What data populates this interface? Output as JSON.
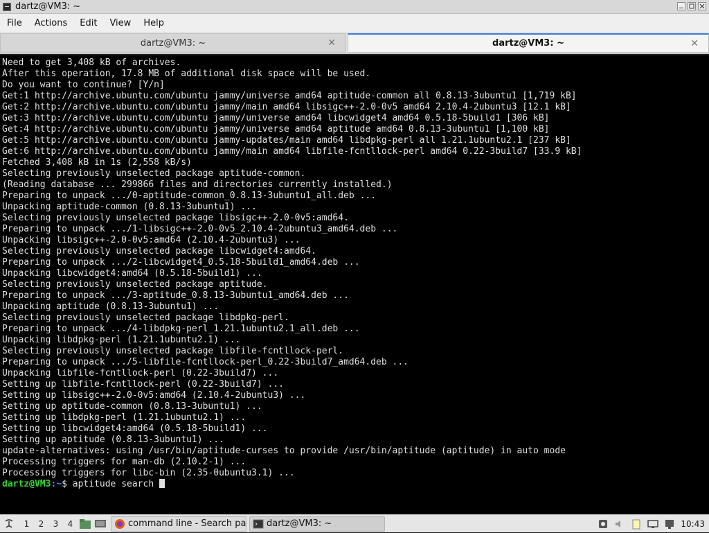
{
  "window": {
    "title": "dartz@VM3: ~"
  },
  "menu": [
    "File",
    "Actions",
    "Edit",
    "View",
    "Help"
  ],
  "tabs": [
    {
      "label": "dartz@VM3: ~",
      "active": false
    },
    {
      "label": "dartz@VM3: ~",
      "active": true
    }
  ],
  "terminal": {
    "lines": [
      "Need to get 3,408 kB of archives.",
      "After this operation, 17.8 MB of additional disk space will be used.",
      "Do you want to continue? [Y/n]",
      "Get:1 http://archive.ubuntu.com/ubuntu jammy/universe amd64 aptitude-common all 0.8.13-3ubuntu1 [1,719 kB]",
      "Get:2 http://archive.ubuntu.com/ubuntu jammy/main amd64 libsigc++-2.0-0v5 amd64 2.10.4-2ubuntu3 [12.1 kB]",
      "Get:3 http://archive.ubuntu.com/ubuntu jammy/universe amd64 libcwidget4 amd64 0.5.18-5build1 [306 kB]",
      "Get:4 http://archive.ubuntu.com/ubuntu jammy/universe amd64 aptitude amd64 0.8.13-3ubuntu1 [1,100 kB]",
      "Get:5 http://archive.ubuntu.com/ubuntu jammy-updates/main amd64 libdpkg-perl all 1.21.1ubuntu2.1 [237 kB]",
      "Get:6 http://archive.ubuntu.com/ubuntu jammy/main amd64 libfile-fcntllock-perl amd64 0.22-3build7 [33.9 kB]",
      "Fetched 3,408 kB in 1s (2,558 kB/s)",
      "Selecting previously unselected package aptitude-common.",
      "(Reading database ... 299866 files and directories currently installed.)",
      "Preparing to unpack .../0-aptitude-common_0.8.13-3ubuntu1_all.deb ...",
      "Unpacking aptitude-common (0.8.13-3ubuntu1) ...",
      "Selecting previously unselected package libsigc++-2.0-0v5:amd64.",
      "Preparing to unpack .../1-libsigc++-2.0-0v5_2.10.4-2ubuntu3_amd64.deb ...",
      "Unpacking libsigc++-2.0-0v5:amd64 (2.10.4-2ubuntu3) ...",
      "Selecting previously unselected package libcwidget4:amd64.",
      "Preparing to unpack .../2-libcwidget4_0.5.18-5build1_amd64.deb ...",
      "Unpacking libcwidget4:amd64 (0.5.18-5build1) ...",
      "Selecting previously unselected package aptitude.",
      "Preparing to unpack .../3-aptitude_0.8.13-3ubuntu1_amd64.deb ...",
      "Unpacking aptitude (0.8.13-3ubuntu1) ...",
      "Selecting previously unselected package libdpkg-perl.",
      "Preparing to unpack .../4-libdpkg-perl_1.21.1ubuntu2.1_all.deb ...",
      "Unpacking libdpkg-perl (1.21.1ubuntu2.1) ...",
      "Selecting previously unselected package libfile-fcntllock-perl.",
      "Preparing to unpack .../5-libfile-fcntllock-perl_0.22-3build7_amd64.deb ...",
      "Unpacking libfile-fcntllock-perl (0.22-3build7) ...",
      "Setting up libfile-fcntllock-perl (0.22-3build7) ...",
      "Setting up libsigc++-2.0-0v5:amd64 (2.10.4-2ubuntu3) ...",
      "Setting up aptitude-common (0.8.13-3ubuntu1) ...",
      "Setting up libdpkg-perl (1.21.1ubuntu2.1) ...",
      "Setting up libcwidget4:amd64 (0.5.18-5build1) ...",
      "Setting up aptitude (0.8.13-3ubuntu1) ...",
      "update-alternatives: using /usr/bin/aptitude-curses to provide /usr/bin/aptitude (aptitude) in auto mode",
      "Processing triggers for man-db (2.10.2-1) ...",
      "Processing triggers for libc-bin (2.35-0ubuntu3.1) ..."
    ],
    "prompt": {
      "user": "dartz@VM3",
      "path": ":~",
      "symbol": "$",
      "command": " aptitude search "
    }
  },
  "taskbar": {
    "workspaces": [
      "1",
      "2",
      "3",
      "4"
    ],
    "tasks": [
      {
        "label": "command line - Search pac...",
        "icon": "firefox-icon"
      },
      {
        "label": "dartz@VM3: ~",
        "icon": "terminal-icon"
      }
    ],
    "clock": "10:43"
  }
}
